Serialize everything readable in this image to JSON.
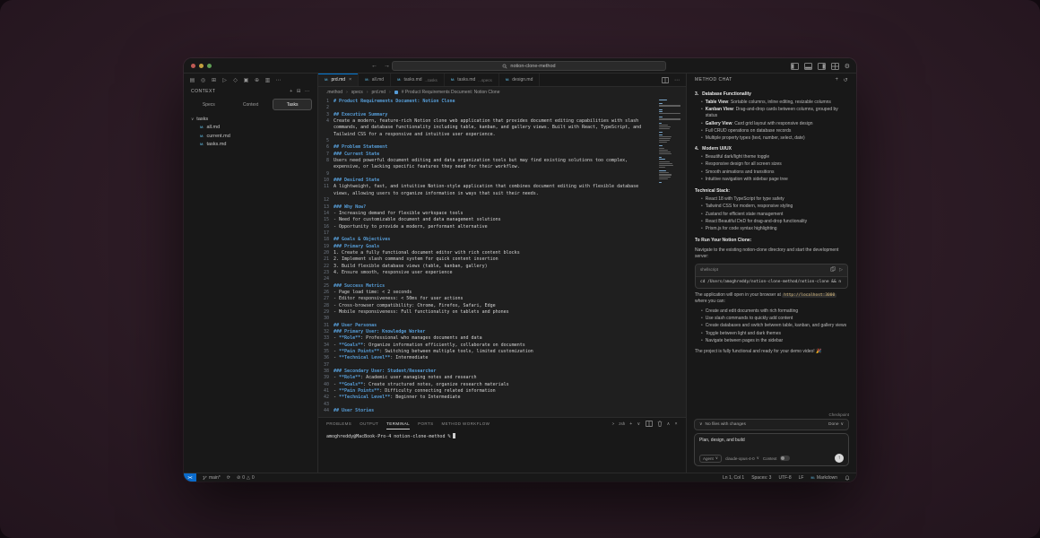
{
  "icons": {
    "back": "←",
    "forward": "→",
    "more": "⋯",
    "add": "+",
    "collapse": "⊟",
    "chevron_down": "∨",
    "chevron_up": "∧",
    "chevron_right": "›",
    "close": "×",
    "remote": "><",
    "markdown_file": "M↓",
    "error": "⊘",
    "warning": "△",
    "sync": "⟳",
    "history": "↺",
    "play": "▷",
    "bullet": "•",
    "gear": "⚙",
    "send": "↑",
    "shell_prompt": ">"
  },
  "titlebar": {
    "search_value": "notion-clone-method"
  },
  "sidebar": {
    "toolbar_icons": [
      "▤",
      "◎",
      "⊞",
      "▷",
      "◇",
      "▣",
      "⊕",
      "▥",
      "⋯"
    ],
    "panel_title": "CONTEXT",
    "tabs": [
      {
        "label": "Specs",
        "active": false
      },
      {
        "label": "Context",
        "active": false
      },
      {
        "label": "Tasks",
        "active": true
      }
    ],
    "tree": {
      "folder": "tasks",
      "files": [
        "all.md",
        "current.md",
        "tasks.md"
      ]
    }
  },
  "editor": {
    "tabs": [
      {
        "name": "prd.md",
        "active": true
      },
      {
        "name": "all.md"
      },
      {
        "name": "tasks.md",
        "hint": "...tasks"
      },
      {
        "name": "tasks.md",
        "hint": "...specs"
      },
      {
        "name": "design.md"
      }
    ],
    "breadcrumbs": [
      ".method",
      "specs",
      "prd.md",
      "# Product Requirements Document: Notion Clone"
    ],
    "lines": [
      {
        "n": 1,
        "t": "h",
        "s": "# Product Requirements Document: Notion Clone"
      },
      {
        "n": 2,
        "t": "p",
        "s": ""
      },
      {
        "n": 3,
        "t": "h",
        "s": "## Executive Summary"
      },
      {
        "n": 4,
        "t": "p",
        "s": "Create a modern, feature-rich Notion clone web application that provides document editing capabilities with slash commands, and database functionality including table, kanban, and gallery views. Built with React, TypeScript, and Tailwind CSS for a responsive and intuitive user experience."
      },
      {
        "n": 5,
        "t": "p",
        "s": ""
      },
      {
        "n": 6,
        "t": "h",
        "s": "## Problem Statement"
      },
      {
        "n": 7,
        "t": "h",
        "s": "### Current State"
      },
      {
        "n": 8,
        "t": "p",
        "s": "Users need powerful document editing and data organization tools but may find existing solutions too complex, expensive, or lacking specific features they need for their workflow."
      },
      {
        "n": 9,
        "t": "p",
        "s": ""
      },
      {
        "n": 10,
        "t": "h",
        "s": "### Desired State"
      },
      {
        "n": 11,
        "t": "p",
        "s": "A lightweight, fast, and intuitive Notion-style application that combines document editing with flexible database views, allowing users to organize information in ways that suit their needs."
      },
      {
        "n": 12,
        "t": "p",
        "s": ""
      },
      {
        "n": 13,
        "t": "h",
        "s": "### Why Now?"
      },
      {
        "n": 14,
        "t": "p",
        "s": "- Increasing demand for flexible workspace tools"
      },
      {
        "n": 15,
        "t": "p",
        "s": "- Need for customizable document and data management solutions"
      },
      {
        "n": 16,
        "t": "p",
        "s": "- Opportunity to provide a modern, performant alternative"
      },
      {
        "n": 17,
        "t": "p",
        "s": ""
      },
      {
        "n": 18,
        "t": "h",
        "s": "## Goals & Objectives"
      },
      {
        "n": 19,
        "t": "h",
        "s": "### Primary Goals"
      },
      {
        "n": 20,
        "t": "p",
        "s": "1. Create a fully functional document editor with rich content blocks"
      },
      {
        "n": 21,
        "t": "p",
        "s": "2. Implement slash command system for quick content insertion"
      },
      {
        "n": 22,
        "t": "p",
        "s": "3. Build flexible database views (table, kanban, gallery)"
      },
      {
        "n": 23,
        "t": "p",
        "s": "4. Ensure smooth, responsive user experience"
      },
      {
        "n": 24,
        "t": "p",
        "s": ""
      },
      {
        "n": 25,
        "t": "h",
        "s": "### Success Metrics"
      },
      {
        "n": 26,
        "t": "p",
        "s": "- Page load time: < 2 seconds"
      },
      {
        "n": 27,
        "t": "p",
        "s": "- Editor responsiveness: < 50ms for user actions"
      },
      {
        "n": 28,
        "t": "p",
        "s": "- Cross-browser compatibility: Chrome, Firefox, Safari, Edge"
      },
      {
        "n": 29,
        "t": "p",
        "s": "- Mobile responsiveness: Full functionality on tablets and phones"
      },
      {
        "n": 30,
        "t": "p",
        "s": ""
      },
      {
        "n": 31,
        "t": "h",
        "s": "## User Personas"
      },
      {
        "n": 32,
        "t": "h",
        "s": "### Primary User: Knowledge Worker"
      },
      {
        "n": 33,
        "t": "p",
        "s": "- **Role**: Professional who manages documents and data"
      },
      {
        "n": 34,
        "t": "p",
        "s": "- **Goals**: Organize information efficiently, collaborate on documents"
      },
      {
        "n": 35,
        "t": "p",
        "s": "- **Pain Points**: Switching between multiple tools, limited customization"
      },
      {
        "n": 36,
        "t": "p",
        "s": "- **Technical Level**: Intermediate"
      },
      {
        "n": 37,
        "t": "p",
        "s": ""
      },
      {
        "n": 38,
        "t": "h",
        "s": "### Secondary User: Student/Researcher"
      },
      {
        "n": 39,
        "t": "p",
        "s": "- **Role**: Academic user managing notes and research"
      },
      {
        "n": 40,
        "t": "p",
        "s": "- **Goals**: Create structured notes, organize research materials"
      },
      {
        "n": 41,
        "t": "p",
        "s": "- **Pain Points**: Difficulty connecting related information"
      },
      {
        "n": 42,
        "t": "p",
        "s": "- **Technical Level**: Beginner to Intermediate"
      },
      {
        "n": 43,
        "t": "p",
        "s": ""
      },
      {
        "n": 44,
        "t": "h",
        "s": "## User Stories"
      }
    ]
  },
  "terminal": {
    "tabs": [
      "PROBLEMS",
      "OUTPUT",
      "TERMINAL",
      "PORTS",
      "METHOD WORKFLOW"
    ],
    "active_tab": "TERMINAL",
    "shell": "zsh",
    "prompt": "amoghreddy@MacBook-Pro-4 notion-clone-method %"
  },
  "chat": {
    "title": "METHOD CHAT",
    "blocks": [
      {
        "type": "numbered",
        "num": "3.",
        "title": "Database Functionality",
        "bullets": [
          {
            "lead": "Table View",
            "text": ": Sortable columns, inline editing, resizable columns"
          },
          {
            "lead": "Kanban View",
            "text": ": Drag-and-drop cards between columns, grouped by status"
          },
          {
            "lead": "Gallery View",
            "text": ": Card grid layout with responsive design"
          },
          {
            "text": "Full CRUD operations on database records"
          },
          {
            "text": "Multiple property types (text, number, select, date)"
          }
        ]
      },
      {
        "type": "numbered",
        "num": "4.",
        "title": "Modern UI/UX",
        "bullets": [
          {
            "text": "Beautiful dark/light theme toggle"
          },
          {
            "text": "Responsive design for all screen sizes"
          },
          {
            "text": "Smooth animations and transitions"
          },
          {
            "text": "Intuitive navigation with sidebar page tree"
          }
        ]
      },
      {
        "type": "heading",
        "text": "Technical Stack:"
      },
      {
        "type": "bullets",
        "bullets": [
          {
            "text": "React 18 with TypeScript for type safety"
          },
          {
            "text": "Tailwind CSS for modern, responsive styling"
          },
          {
            "text": "Zustand for efficient state management"
          },
          {
            "text": "React Beautiful DnD for drag-and-drop functionality"
          },
          {
            "text": "Prism.js for code syntax highlighting"
          }
        ]
      },
      {
        "type": "heading",
        "text": "To Run Your Notion Clone:"
      },
      {
        "type": "para",
        "text": "Navigate to the existing notion-clone directory and start the development server:"
      },
      {
        "type": "code",
        "lang": "shellscript",
        "code": "cd /Users/amoghreddy/notion-clone-method/notion-clone && n"
      },
      {
        "type": "para_code",
        "pre": "The application will open in your browser at ",
        "code": "http://localhost:3000",
        "post": " where you can:"
      },
      {
        "type": "bullets",
        "bullets": [
          {
            "text": "Create and edit documents with rich formatting"
          },
          {
            "text": "Use slash commands to quickly add content"
          },
          {
            "text": "Create databases and switch between table, kanban, and gallery views"
          },
          {
            "text": "Toggle between light and dark themes"
          },
          {
            "text": "Navigate between pages in the sidebar"
          }
        ]
      },
      {
        "type": "para",
        "text": "The project is fully functional and ready for your demo video! 🎉"
      }
    ],
    "checkpoint_label": "Checkpoint",
    "files_box": {
      "collapsed_label": "No files with changes",
      "action_label": "Done"
    },
    "composer": {
      "text": "Plan, design, and build",
      "agent_label": "Agent",
      "model_label": "claude-opus-4-0",
      "context_label": "Context"
    }
  },
  "statusbar": {
    "branch": "main*",
    "errors": "0",
    "warnings": "0",
    "line_col": "Ln 1, Col 1",
    "indent": "Spaces: 3",
    "encoding": "UTF-8",
    "eol": "LF",
    "language": "Markdown"
  }
}
